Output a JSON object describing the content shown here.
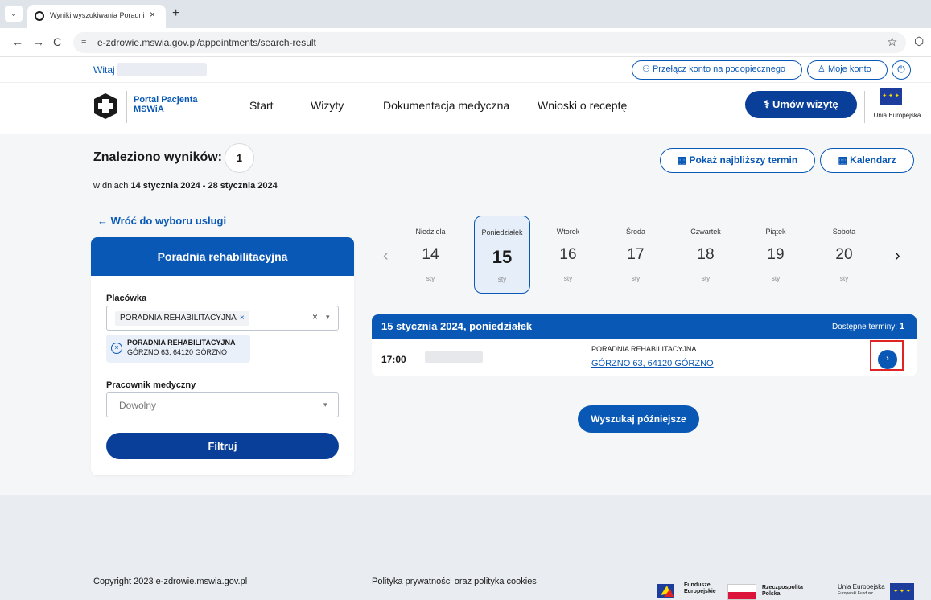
{
  "browser": {
    "tab_title": "Wyniki wyszukiwania Poradnia reh",
    "tab_close": "×",
    "new_tab": "+",
    "url": "e-zdrowie.mswia.gov.pl/appointments/search-result",
    "back": "←",
    "forward": "→",
    "reload": "C",
    "site_settings_icon": "≡",
    "bookmark_star": "☆",
    "extension_icon": "⬡",
    "tab_menu": "⌄"
  },
  "topstrip": {
    "greeting": "Witaj",
    "switch_account": "Przełącz konto na podopiecznego",
    "switch_icon": "⚇",
    "my_account": "Moje konto",
    "account_icon": "♙",
    "power_icon": "⏻"
  },
  "header": {
    "logo_line1": "Portal Pacjenta",
    "logo_line2": "MSWiA",
    "menu": [
      "Start",
      "Wizyty",
      "Dokumentacja medyczna",
      "Wnioski o receptę"
    ],
    "book_button": "Umów wizytę",
    "book_icon": "⚕",
    "eu_label": "Unia Europejska",
    "eu_stars": "✦ ✦ ✦"
  },
  "results": {
    "label": "Znaleziono wyników:",
    "count": "1",
    "range_prefix": "w dniach ",
    "range_value": "14 stycznia 2024 - 28 stycznia 2024",
    "nearest_button": "Pokaż najbliższy termin",
    "calendar_button": "Kalendarz",
    "calendar_icon": "▦"
  },
  "back_link": "← Wróć do wyboru usługi",
  "filter": {
    "title": "Poradnia rehabilitacyjna",
    "facility_label": "Placówka",
    "facility_chip": "PORADNIA REHABILITACYJNA",
    "chip_remove": "×",
    "clear": "×",
    "caret": "▾",
    "selected_name": "PORADNIA REHABILITACYJNA",
    "selected_address": "GÓRZNO 63, 64120 GÓRZNO",
    "deselect_icon": "×",
    "staff_label": "Pracownik medyczny",
    "staff_placeholder": "Dowolny",
    "filter_button": "Filtruj"
  },
  "dates": {
    "prev": "‹",
    "next": "›",
    "days": [
      {
        "name": "Niedziela",
        "num": "14",
        "month": "sty"
      },
      {
        "name": "Poniedziałek",
        "num": "15",
        "month": "sty"
      },
      {
        "name": "Wtorek",
        "num": "16",
        "month": "sty"
      },
      {
        "name": "Środa",
        "num": "17",
        "month": "sty"
      },
      {
        "name": "Czwartek",
        "num": "18",
        "month": "sty"
      },
      {
        "name": "Piątek",
        "num": "19",
        "month": "sty"
      },
      {
        "name": "Sobota",
        "num": "20",
        "month": "sty"
      }
    ],
    "selected_index": 1
  },
  "result_card": {
    "date": "15 stycznia 2024, poniedziałek",
    "available_label": "Dostępne terminy: ",
    "available_count": "1",
    "time": "17:00",
    "clinic": "PORADNIA REHABILITACYJNA",
    "address": "GÓRZNO 63, 64120 GÓRZNO",
    "go_icon": "›"
  },
  "later_button": "Wyszukaj późniejsze",
  "footer": {
    "copyright": "Copyright 2023 e-zdrowie.mswia.gov.pl",
    "privacy": "Polityka prywatności oraz polityka cookies",
    "fe_line1": "Fundusze",
    "fe_line2": "Europejskie",
    "pl_line1": "Rzeczpospolita",
    "pl_line2": "Polska",
    "ue_line1": "Unia Europejska",
    "ue_line2": "Europejski Fundusz",
    "ue_stars": "✦ ✦ ✦"
  },
  "colors": {
    "primary": "#0a58b5",
    "primary_dark": "#0a3f99",
    "highlight": "#e02424"
  }
}
